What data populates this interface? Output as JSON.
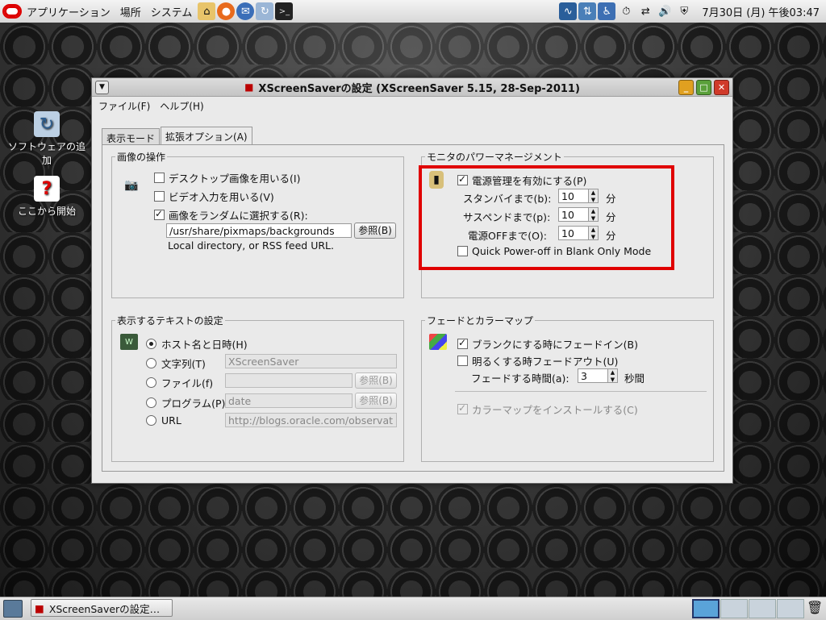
{
  "top_panel": {
    "menus": [
      "アプリケーション",
      "場所",
      "システム"
    ],
    "clock": "7月30日 (月) 午後03:47"
  },
  "desktop_icons": [
    {
      "label": "ソフトウェアの追加",
      "icon": "software-update-icon"
    },
    {
      "label": "ここから開始",
      "icon": "help-icon"
    }
  ],
  "window": {
    "title": "XScreenSaverの設定  (XScreenSaver 5.15, 28-Sep-2011)",
    "menu": {
      "file": "ファイル(F)",
      "help": "ヘルプ(H)"
    },
    "tabs": [
      "表示モード",
      "拡張オプション(A)"
    ],
    "image_ops": {
      "legend": "画像の操作",
      "desktop_images": "デスクトップ画像を用いる(I)",
      "video_input": "ビデオ入力を用いる(V)",
      "random_image": "画像をランダムに選択する(R):",
      "path": "/usr/share/pixmaps/backgrounds",
      "browse": "参照(B)",
      "hint": "Local directory, or RSS feed URL."
    },
    "power": {
      "legend": "モニタのパワーマネージメント",
      "enable": "電源管理を有効にする(P)",
      "standby_label": "スタンバイまで(b):",
      "standby_value": "10",
      "suspend_label": "サスペンドまで(p):",
      "suspend_value": "10",
      "off_label": "電源OFFまで(O):",
      "off_value": "10",
      "unit": "分",
      "quick_off": "Quick Power-off in Blank Only Mode"
    },
    "text_settings": {
      "legend": "表示するテキストの設定",
      "host_date": "ホスト名と日時(H)",
      "string": "文字列(T)",
      "string_value": "XScreenSaver",
      "file": "ファイル(f)",
      "file_value": "",
      "program": "プログラム(P)",
      "program_value": "date",
      "url": "URL",
      "url_value": "http://blogs.oracle.com/observat",
      "browse": "参照(B)"
    },
    "fade": {
      "legend": "フェードとカラーマップ",
      "fade_in": "ブランクにする時にフェードイン(B)",
      "fade_out": "明るくする時フェードアウト(U)",
      "duration_label": "フェードする時間(a):",
      "duration_value": "3",
      "duration_unit": "秒間",
      "install_colormap": "カラーマップをインストールする(C)"
    }
  },
  "taskbar": {
    "task": "XScreenSaverの設定…"
  },
  "colors": {
    "highlight": "#e00000"
  }
}
